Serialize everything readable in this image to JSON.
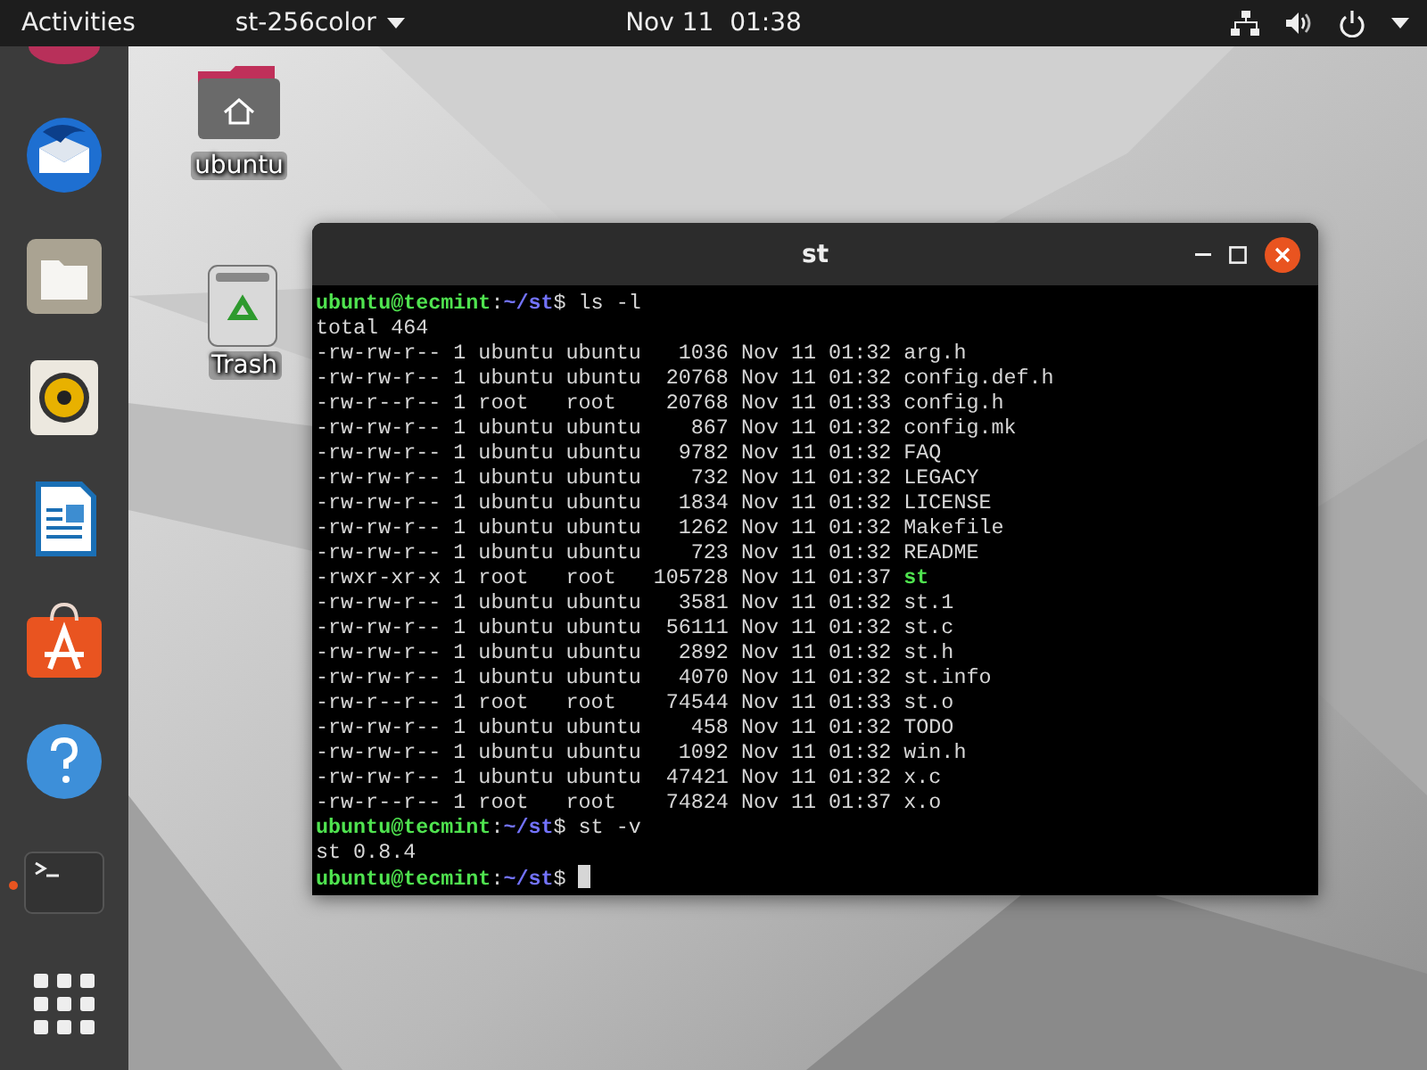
{
  "top_bar": {
    "activities": "Activities",
    "app_menu": "st-256color",
    "clock": "Nov 11  01:38"
  },
  "dock": {
    "items": [
      {
        "kind": "cut"
      },
      {
        "kind": "mail",
        "running": false
      },
      {
        "kind": "files",
        "running": false
      },
      {
        "kind": "speaker",
        "running": false
      },
      {
        "kind": "writer",
        "running": false
      },
      {
        "kind": "store",
        "running": false
      },
      {
        "kind": "help",
        "running": false
      },
      {
        "kind": "terminal",
        "running": true
      },
      {
        "kind": "apps",
        "running": false
      }
    ]
  },
  "desktop_icons": [
    {
      "kind": "home",
      "label": "ubuntu"
    },
    {
      "kind": "trash",
      "label": "Trash"
    }
  ],
  "window": {
    "title": "st",
    "lines": [
      {
        "kind": "prompt",
        "host": "ubuntu@tecmint",
        "sep": ":",
        "path": "~/st",
        "sign": "$",
        "command": "ls -l",
        "cursor": false
      },
      {
        "kind": "output",
        "text": "total 464"
      },
      {
        "kind": "entry",
        "meta": "-rw-rw-r-- 1 ubuntu ubuntu   1036 Nov 11 01:32",
        "file": "arg.h",
        "executable": false
      },
      {
        "kind": "entry",
        "meta": "-rw-rw-r-- 1 ubuntu ubuntu  20768 Nov 11 01:32",
        "file": "config.def.h",
        "executable": false
      },
      {
        "kind": "entry",
        "meta": "-rw-r--r-- 1 root   root    20768 Nov 11 01:33",
        "file": "config.h",
        "executable": false
      },
      {
        "kind": "entry",
        "meta": "-rw-rw-r-- 1 ubuntu ubuntu    867 Nov 11 01:32",
        "file": "config.mk",
        "executable": false
      },
      {
        "kind": "entry",
        "meta": "-rw-rw-r-- 1 ubuntu ubuntu   9782 Nov 11 01:32",
        "file": "FAQ",
        "executable": false
      },
      {
        "kind": "entry",
        "meta": "-rw-rw-r-- 1 ubuntu ubuntu    732 Nov 11 01:32",
        "file": "LEGACY",
        "executable": false
      },
      {
        "kind": "entry",
        "meta": "-rw-rw-r-- 1 ubuntu ubuntu   1834 Nov 11 01:32",
        "file": "LICENSE",
        "executable": false
      },
      {
        "kind": "entry",
        "meta": "-rw-rw-r-- 1 ubuntu ubuntu   1262 Nov 11 01:32",
        "file": "Makefile",
        "executable": false
      },
      {
        "kind": "entry",
        "meta": "-rw-rw-r-- 1 ubuntu ubuntu    723 Nov 11 01:32",
        "file": "README",
        "executable": false
      },
      {
        "kind": "entry",
        "meta": "-rwxr-xr-x 1 root   root   105728 Nov 11 01:37",
        "file": "st",
        "executable": true
      },
      {
        "kind": "entry",
        "meta": "-rw-rw-r-- 1 ubuntu ubuntu   3581 Nov 11 01:32",
        "file": "st.1",
        "executable": false
      },
      {
        "kind": "entry",
        "meta": "-rw-rw-r-- 1 ubuntu ubuntu  56111 Nov 11 01:32",
        "file": "st.c",
        "executable": false
      },
      {
        "kind": "entry",
        "meta": "-rw-rw-r-- 1 ubuntu ubuntu   2892 Nov 11 01:32",
        "file": "st.h",
        "executable": false
      },
      {
        "kind": "entry",
        "meta": "-rw-rw-r-- 1 ubuntu ubuntu   4070 Nov 11 01:32",
        "file": "st.info",
        "executable": false
      },
      {
        "kind": "entry",
        "meta": "-rw-r--r-- 1 root   root    74544 Nov 11 01:33",
        "file": "st.o",
        "executable": false
      },
      {
        "kind": "entry",
        "meta": "-rw-rw-r-- 1 ubuntu ubuntu    458 Nov 11 01:32",
        "file": "TODO",
        "executable": false
      },
      {
        "kind": "entry",
        "meta": "-rw-rw-r-- 1 ubuntu ubuntu   1092 Nov 11 01:32",
        "file": "win.h",
        "executable": false
      },
      {
        "kind": "entry",
        "meta": "-rw-rw-r-- 1 ubuntu ubuntu  47421 Nov 11 01:32",
        "file": "x.c",
        "executable": false
      },
      {
        "kind": "entry",
        "meta": "-rw-r--r-- 1 root   root    74824 Nov 11 01:37",
        "file": "x.o",
        "executable": false
      },
      {
        "kind": "prompt",
        "host": "ubuntu@tecmint",
        "sep": ":",
        "path": "~/st",
        "sign": "$",
        "command": "st -v",
        "cursor": false
      },
      {
        "kind": "output",
        "text": "st 0.8.4"
      },
      {
        "kind": "prompt",
        "host": "ubuntu@tecmint",
        "sep": ":",
        "path": "~/st",
        "sign": "$",
        "cursor": true
      }
    ]
  }
}
